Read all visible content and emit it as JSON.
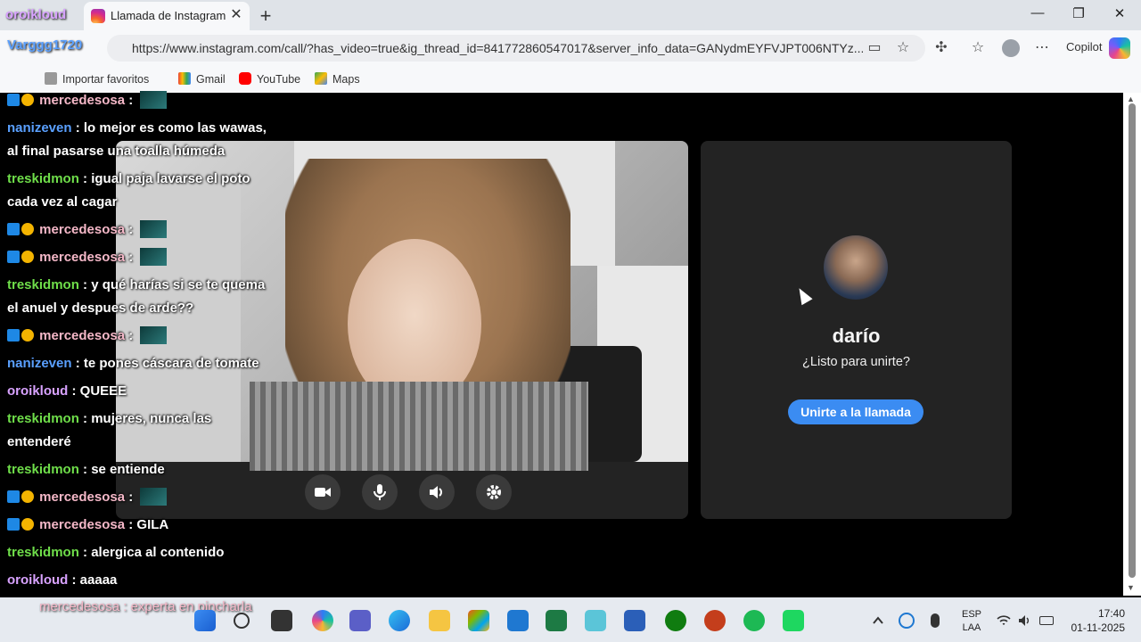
{
  "browser": {
    "tab_title": "Llamada de Instagram",
    "url": "https://www.instagram.com/call/?has_video=true&ig_thread_id=841772860547017&server_info_data=GANydmEYFVJPT006NTYz...",
    "copilot_label": "Copilot",
    "bookmarks": {
      "import": "Importar favoritos",
      "gmail": "Gmail",
      "youtube": "YouTube",
      "maps": "Maps"
    }
  },
  "call": {
    "name": "darío",
    "prompt": "¿Listo para unirte?",
    "join_label": "Unirte a la llamada"
  },
  "stream_overlay": {
    "user1": "oroikloud",
    "user2": "Varggg1720",
    "bottom_chat": "mercedesosa : experta en pincharla"
  },
  "chat": [
    {
      "user": "mercedesosa",
      "color": "pink",
      "text": "",
      "badges": true,
      "emote": true
    },
    {
      "user": "nanizeven",
      "color": "blue",
      "text": "lo mejor es como las wawas,",
      "cont": "al final pasarse una toalla húmeda"
    },
    {
      "user": "treskidmon",
      "color": "green",
      "text": "igual paja lavarse el poto",
      "cont": "cada vez al cagar"
    },
    {
      "user": "mercedesosa",
      "color": "pink",
      "text": "",
      "badges": true,
      "emote": true
    },
    {
      "user": "mercedesosa",
      "color": "pink",
      "text": "",
      "badges": true,
      "emote": true
    },
    {
      "user": "treskidmon",
      "color": "green",
      "text": "y qué harías si se te quema",
      "cont": "el anuel y despues de arde??"
    },
    {
      "user": "mercedesosa",
      "color": "pink",
      "text": "",
      "badges": true,
      "emote": true
    },
    {
      "user": "nanizeven",
      "color": "blue",
      "text": "te pones cáscara de tomate"
    },
    {
      "user": "oroikloud",
      "color": "purple",
      "text": "QUEEE"
    },
    {
      "user": "treskidmon",
      "color": "green",
      "text": "mujeres, nunca las",
      "cont": "entenderé"
    },
    {
      "user": "treskidmon",
      "color": "green",
      "text": "se entiende"
    },
    {
      "user": "mercedesosa",
      "color": "pink",
      "text": "",
      "badges": true,
      "emote": true
    },
    {
      "user": "mercedesosa",
      "color": "pink",
      "text": "GILA",
      "badges": true
    },
    {
      "user": "treskidmon",
      "color": "green",
      "text": "alergica al contenido"
    },
    {
      "user": "oroikloud",
      "color": "purple",
      "text": "aaaaa"
    }
  ],
  "taskbar": {
    "lang_top": "ESP",
    "lang_bottom": "LAA",
    "time": "17:40",
    "date": "01-11-2025"
  }
}
